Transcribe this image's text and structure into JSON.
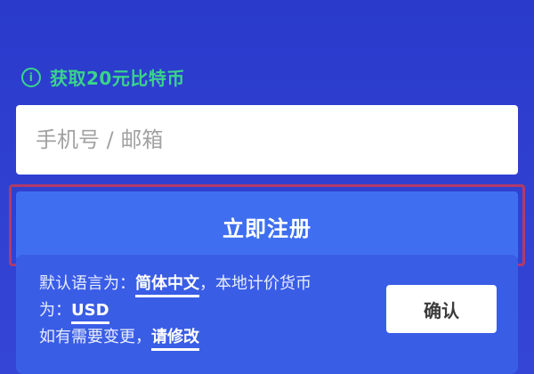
{
  "promo": {
    "icon": "info-icon",
    "text": "获取20元比特币"
  },
  "account_input": {
    "placeholder": "手机号 / 邮箱",
    "value": ""
  },
  "register_button": {
    "label": "立即注册"
  },
  "language_notice": {
    "line1_prefix": "默认语言为：",
    "language": "简体中文",
    "line1_suffix": "，本地计价货币",
    "line2_prefix": "为：",
    "currency": "USD",
    "line3_prefix": "如有需要变更，",
    "change_link": "请修改",
    "confirm_label": "确认"
  },
  "colors": {
    "background": "#2f3fc9",
    "accent_green": "#39d58a",
    "button_blue": "#3f6ff0",
    "highlight": "#b23a6a"
  }
}
